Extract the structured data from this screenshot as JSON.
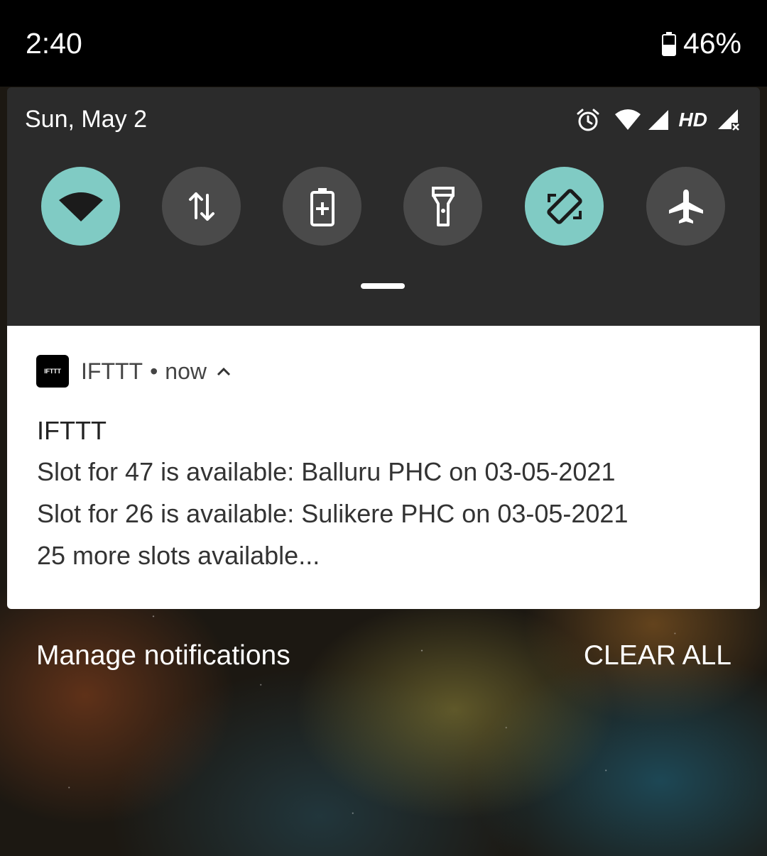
{
  "status_bar": {
    "time": "2:40",
    "battery_percent": "46%"
  },
  "quick_settings": {
    "date": "Sun, May 2",
    "network_label": "HD",
    "tiles": [
      {
        "icon": "wifi-icon",
        "active": true
      },
      {
        "icon": "mobile-data-icon",
        "active": false
      },
      {
        "icon": "battery-saver-icon",
        "active": false
      },
      {
        "icon": "flashlight-icon",
        "active": false
      },
      {
        "icon": "auto-rotate-icon",
        "active": true
      },
      {
        "icon": "airplane-mode-icon",
        "active": false
      }
    ],
    "accent_color": "#80cbc4"
  },
  "notification": {
    "app_icon_text": "IFTTT",
    "app_name": "IFTTT",
    "separator": "•",
    "time": "now",
    "title": "IFTTT",
    "lines": [
      "Slot for 47 is available: Balluru PHC on 03-05-2021",
      "Slot for 26 is available: Sulikere PHC on 03-05-2021",
      "25 more slots available..."
    ]
  },
  "footer": {
    "manage_label": "Manage notifications",
    "clear_label": "CLEAR ALL"
  }
}
